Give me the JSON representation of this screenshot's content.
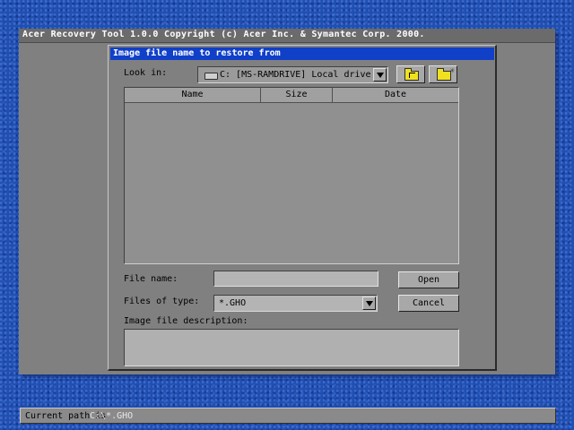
{
  "app": {
    "title": "Acer Recovery Tool 1.0.0   Copyright (c) Acer Inc. & Symantec Corp. 2000."
  },
  "dialog": {
    "title": "Image file name to restore from",
    "look_in_label": "Look in:",
    "look_in_value": "C: [MS-RAMDRIVE] Local drive",
    "columns": [
      "Name",
      "Size",
      "Date"
    ],
    "file_name_label": "File name:",
    "file_name_value": "",
    "files_of_type_label": "Files of type:",
    "files_of_type_value": "*.GHO",
    "description_label": "Image file description:",
    "description_value": "",
    "open_label": "Open",
    "cancel_label": "Cancel"
  },
  "status": {
    "label": "Current path is",
    "value": "C:\\*.GHO"
  },
  "colors": {
    "desktop": "#1f4fb0",
    "dialog_titlebar": "#1040c8",
    "window_bg": "#808080"
  }
}
